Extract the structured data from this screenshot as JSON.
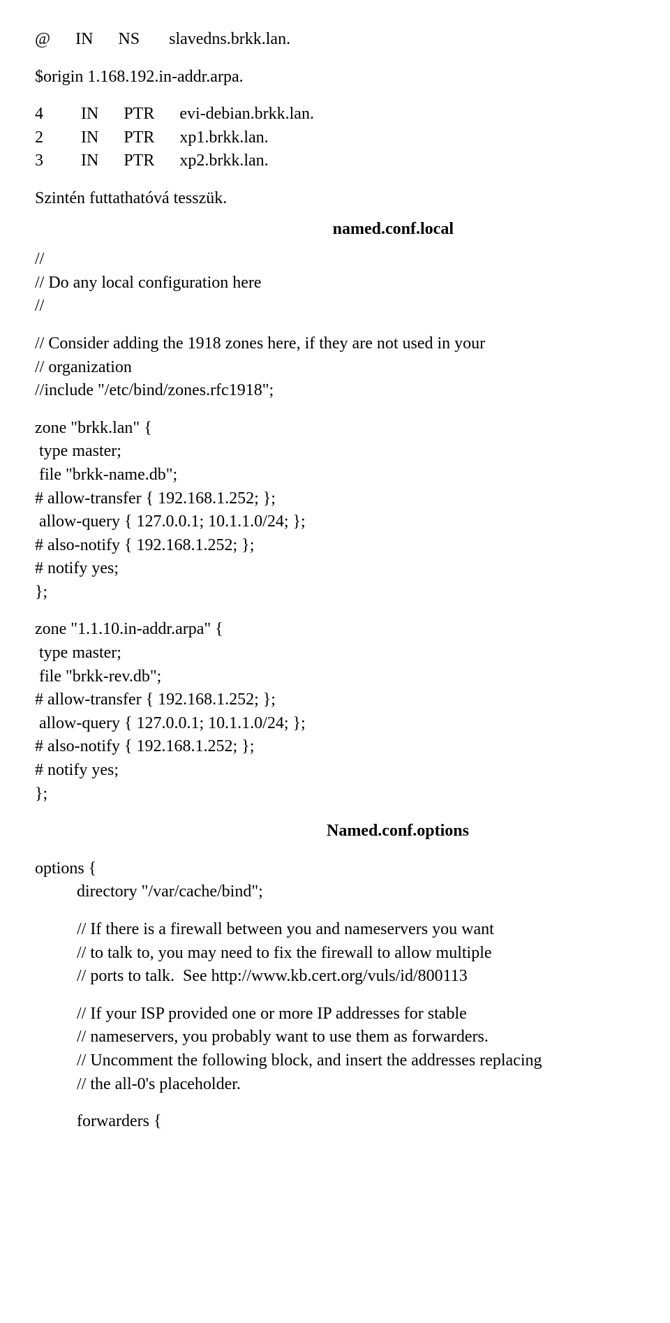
{
  "top": {
    "ns_line": "@      IN      NS       slavedns.brkk.lan.",
    "origin": "$origin 1.168.192.in-addr.arpa.",
    "ptr1": "4         IN      PTR      evi-debian.brkk.lan.",
    "ptr2": "2         IN      PTR      xp1.brkk.lan.",
    "ptr3": "3         IN      PTR      xp2.brkk.lan.",
    "runnable": "Szintén futtathatóvá tesszük."
  },
  "heading1": "named.conf.local",
  "localconf": {
    "l1": "//",
    "l2": "// Do any local configuration here",
    "l3": "//",
    "l4": "// Consider adding the 1918 zones here, if they are not used in your",
    "l5": "// organization",
    "l6": "//include \"/etc/bind/zones.rfc1918\";"
  },
  "zone1": {
    "l1": "zone \"brkk.lan\" {",
    "l2": " type master;",
    "l3": " file \"brkk-name.db\";",
    "l4": "# allow-transfer { 192.168.1.252; };",
    "l5": " allow-query { 127.0.0.1; 10.1.1.0/24; };",
    "l6": "# also-notify { 192.168.1.252; };",
    "l7": "# notify yes;",
    "l8": "};"
  },
  "zone2": {
    "l1": "zone \"1.1.10.in-addr.arpa\" {",
    "l2": " type master;",
    "l3": " file \"brkk-rev.db\";",
    "l4": "# allow-transfer { 192.168.1.252; };",
    "l5": " allow-query { 127.0.0.1; 10.1.1.0/24; };",
    "l6": "# also-notify { 192.168.1.252; };",
    "l7": "# notify yes;",
    "l8": "};"
  },
  "heading2": "Named.conf.options",
  "options": {
    "l1": "options {",
    "l2": "directory \"/var/cache/bind\";",
    "c1": "// If there is a firewall between you and nameservers you want",
    "c2": "// to talk to, you may need to fix the firewall to allow multiple",
    "c3": "// ports to talk.  See http://www.kb.cert.org/vuls/id/800113",
    "c4": "// If your ISP provided one or more IP addresses for stable",
    "c5": "// nameservers, you probably want to use them as forwarders.",
    "c6": "// Uncomment the following block, and insert the addresses replacing",
    "c7": "// the all-0's placeholder.",
    "fwd": "forwarders {"
  }
}
